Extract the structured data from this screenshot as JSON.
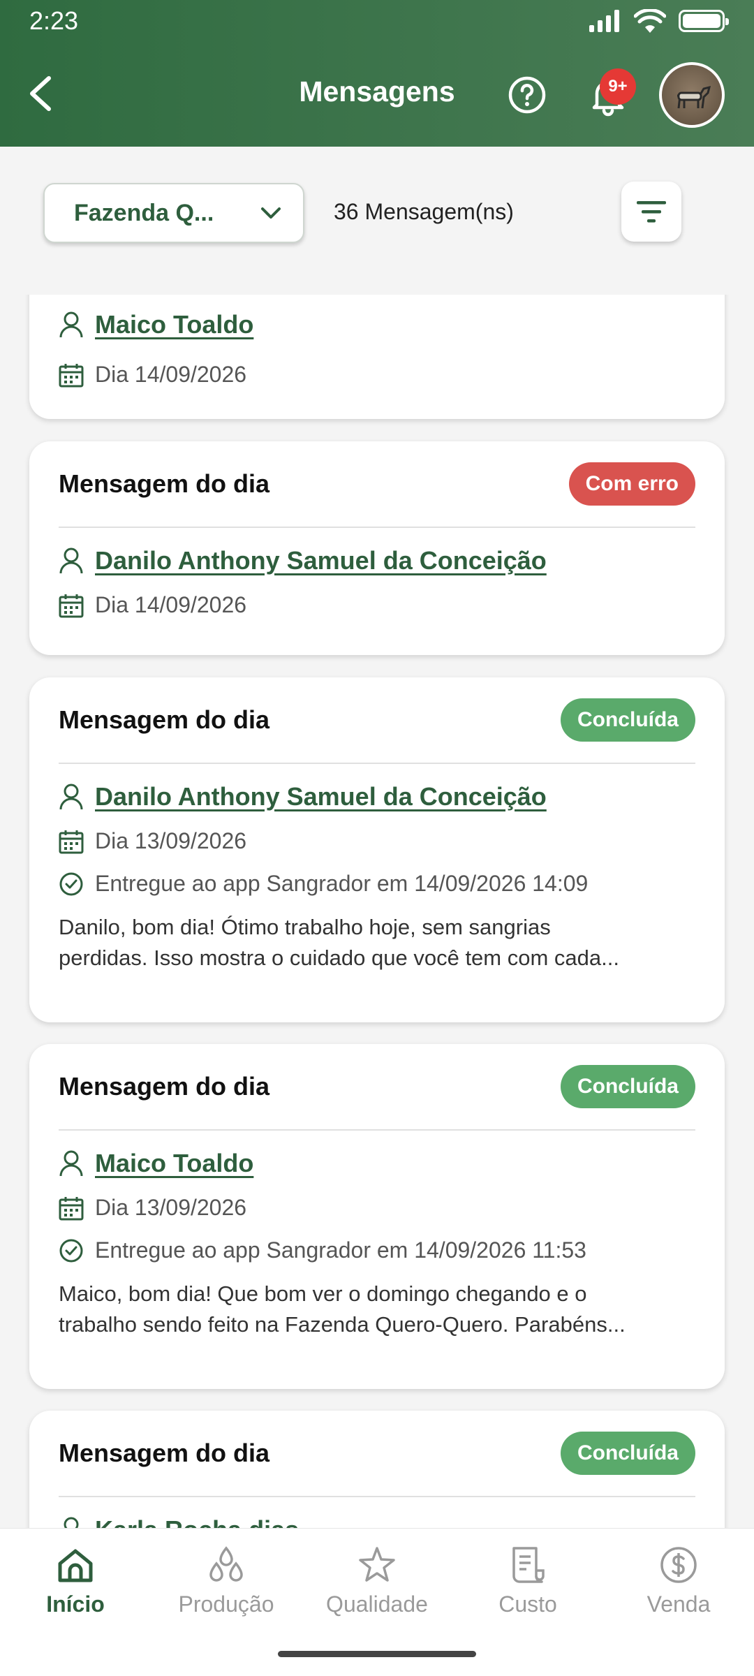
{
  "status_bar": {
    "time": "2:23"
  },
  "header": {
    "title": "Mensagens",
    "notification_badge": "9+"
  },
  "filter": {
    "farm_label": "Fazenda Q...",
    "message_count": "36 Mensagem(ns)"
  },
  "colors": {
    "accent": "#2e5e3d",
    "header": "#3f7650",
    "error": "#d9534f",
    "success": "#5aaa6b"
  },
  "messages": [
    {
      "title": "",
      "status": "",
      "user": "Maico Toaldo",
      "date": "Dia 14/09/2026",
      "delivered": "",
      "preview": []
    },
    {
      "title": "Mensagem do dia",
      "status": "Com erro",
      "user": "Danilo Anthony Samuel da Conceição",
      "date": "Dia 14/09/2026",
      "delivered": "",
      "preview": []
    },
    {
      "title": "Mensagem do dia",
      "status": "Concluída",
      "user": "Danilo Anthony Samuel da Conceição",
      "date": "Dia 13/09/2026",
      "delivered": "Entregue ao app Sangrador em 14/09/2026 14:09",
      "preview": [
        "Danilo, bom dia! Ótimo trabalho hoje, sem sangrias",
        "perdidas. Isso mostra o cuidado que você tem com cada..."
      ]
    },
    {
      "title": "Mensagem do dia",
      "status": "Concluída",
      "user": "Maico Toaldo",
      "date": "Dia 13/09/2026",
      "delivered": "Entregue ao app Sangrador em 14/09/2026 11:53",
      "preview": [
        "Maico, bom dia! Que bom ver o domingo chegando e o",
        "trabalho sendo feito na Fazenda Quero-Quero. Parabéns..."
      ]
    },
    {
      "title": "Mensagem do dia",
      "status": "Concluída",
      "user": "Karla Rocha dias",
      "date": "",
      "delivered": "",
      "preview": []
    }
  ],
  "nav": [
    {
      "label": "Início",
      "icon": "home-icon",
      "active": true
    },
    {
      "label": "Produção",
      "icon": "drops-icon",
      "active": false
    },
    {
      "label": "Qualidade",
      "icon": "star-icon",
      "active": false
    },
    {
      "label": "Custo",
      "icon": "receipt-icon",
      "active": false
    },
    {
      "label": "Venda",
      "icon": "dollar-icon",
      "active": false
    }
  ]
}
